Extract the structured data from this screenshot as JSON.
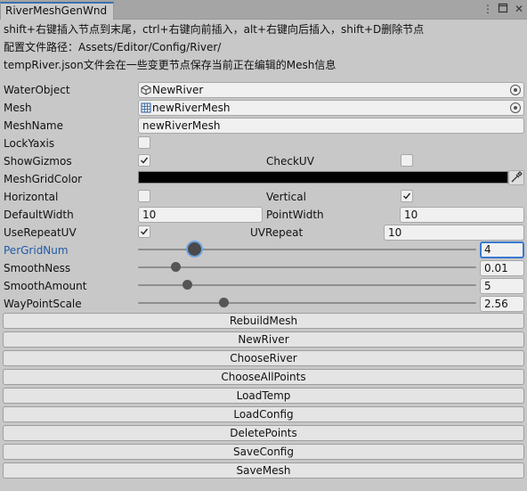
{
  "window": {
    "tab_title": "RiverMeshGenWnd",
    "menu_icon": "kebab-menu-icon",
    "maximize_icon": "maximize-icon",
    "close_icon": "close-icon"
  },
  "help": {
    "line1": "shift+右键插入节点到末尾，ctrl+右键向前插入，alt+右键向后插入，shift+D删除节点",
    "line2": "配置文件路径：Assets/Editor/Config/River/",
    "line3": "tempRiver.json文件会在一些变更节点保存当前正在编辑的Mesh信息"
  },
  "fields": {
    "water_object": {
      "label": "WaterObject",
      "value": "NewRiver",
      "icon": "gameobject-cube-icon"
    },
    "mesh": {
      "label": "Mesh",
      "value": "newRiverMesh",
      "icon": "mesh-grid-icon"
    },
    "mesh_name": {
      "label": "MeshName",
      "value": "newRiverMesh"
    },
    "lock_yaxis": {
      "label": "LockYaxis",
      "checked": false
    },
    "show_gizmos": {
      "label": "ShowGizmos",
      "checked": true
    },
    "check_uv": {
      "label": "CheckUV",
      "checked": false
    },
    "mesh_grid_color": {
      "label": "MeshGridColor",
      "color": "#000000",
      "icon": "eyedropper-icon"
    },
    "horizontal": {
      "label": "Horizontal",
      "checked": false
    },
    "vertical": {
      "label": "Vertical",
      "checked": true
    },
    "default_width": {
      "label": "DefaultWidth",
      "value": "10"
    },
    "point_width": {
      "label": "PointWidth",
      "value": "10"
    },
    "use_repeat_uv": {
      "label": "UseRepeatUV",
      "checked": true
    },
    "uv_repeat": {
      "label": "UVRepeat",
      "value": "10"
    },
    "per_grid_num": {
      "label": "PerGridNum",
      "value": "4",
      "level": 0.16
    },
    "smooth_ness": {
      "label": "SmoothNess",
      "value": "0.01",
      "level": 0.11
    },
    "smooth_amount": {
      "label": "SmoothAmount",
      "value": "5",
      "level": 0.14
    },
    "way_point_scale": {
      "label": "WayPointScale",
      "value": "2.56",
      "level": 0.25
    }
  },
  "buttons": {
    "rebuild_mesh": "RebuildMesh",
    "new_river": "NewRiver",
    "choose_river": "ChooseRiver",
    "choose_all_points": "ChooseAllPoints",
    "load_temp": "LoadTemp",
    "load_config": "LoadConfig",
    "delete_points": "DeletePoints",
    "save_config": "SaveConfig",
    "save_mesh": "SaveMesh"
  },
  "colors": {
    "accent": "#3a79cf",
    "focus_label": "#1f5aa8",
    "panel_bg": "#c8c8c8"
  }
}
